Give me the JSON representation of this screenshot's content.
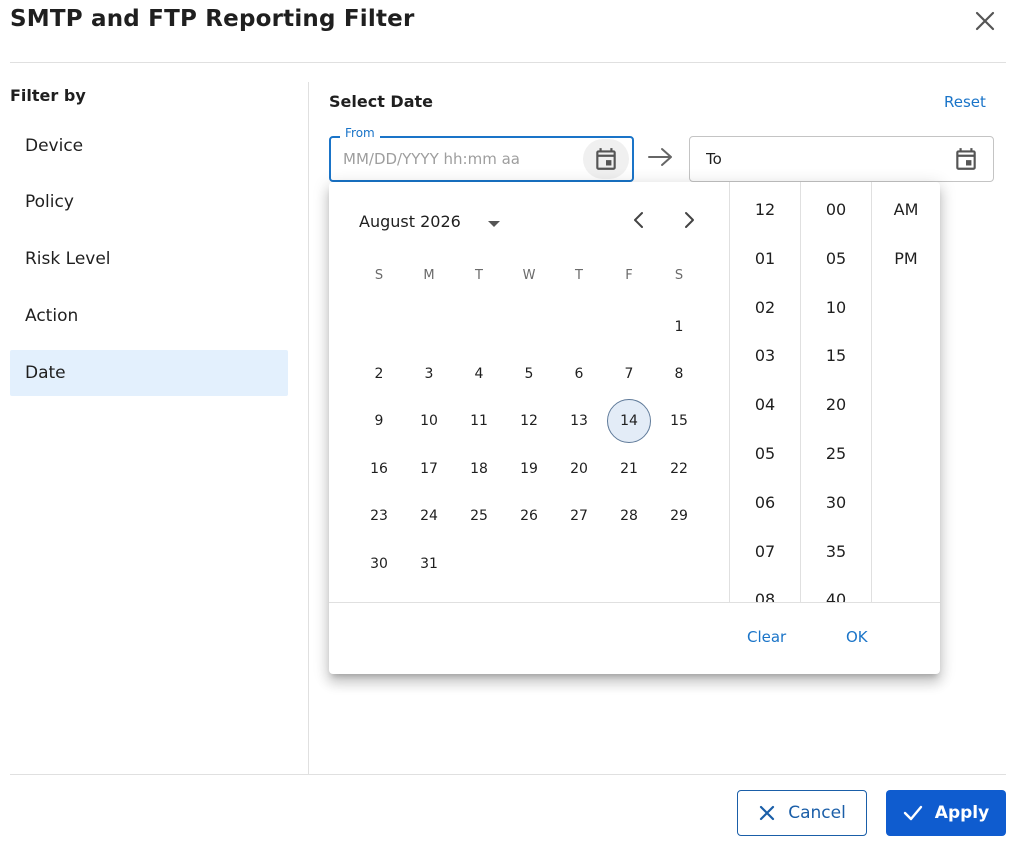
{
  "dialog": {
    "title": "SMTP and FTP Reporting Filter"
  },
  "sidebar": {
    "heading": "Filter by",
    "items": [
      {
        "label": "Device",
        "active": false
      },
      {
        "label": "Policy",
        "active": false
      },
      {
        "label": "Risk Level",
        "active": false
      },
      {
        "label": "Action",
        "active": false
      },
      {
        "label": "Date",
        "active": true
      }
    ]
  },
  "date_filter": {
    "heading": "Select Date",
    "reset_label": "Reset",
    "from": {
      "legend": "From",
      "placeholder": "MM/DD/YYYY hh:mm aa",
      "value": ""
    },
    "to": {
      "placeholder": "To",
      "value": ""
    }
  },
  "picker": {
    "month_label": "August 2026",
    "weekdays": [
      "S",
      "M",
      "T",
      "W",
      "T",
      "F",
      "S"
    ],
    "first_weekday_index": 6,
    "days_in_month": 31,
    "highlighted_day": 14,
    "hours": [
      "12",
      "01",
      "02",
      "03",
      "04",
      "05",
      "06",
      "07",
      "08"
    ],
    "minutes": [
      "00",
      "05",
      "10",
      "15",
      "20",
      "25",
      "30",
      "35",
      "40"
    ],
    "meridiem": [
      "AM",
      "PM"
    ],
    "clear_label": "Clear",
    "ok_label": "OK"
  },
  "footer": {
    "cancel_label": "Cancel",
    "apply_label": "Apply"
  },
  "colors": {
    "accent": "#1a74c8",
    "primary_button": "#0f5ccf",
    "active_item_bg": "#e3f0fd",
    "today_bg": "#e3ecf7"
  },
  "icons": {
    "close": "close-icon",
    "calendar": "calendar-icon",
    "arrow": "arrow-right-icon",
    "caret": "caret-down-icon",
    "prev": "chevron-left-icon",
    "next": "chevron-right-icon",
    "cancel": "x-icon",
    "apply": "check-icon"
  }
}
